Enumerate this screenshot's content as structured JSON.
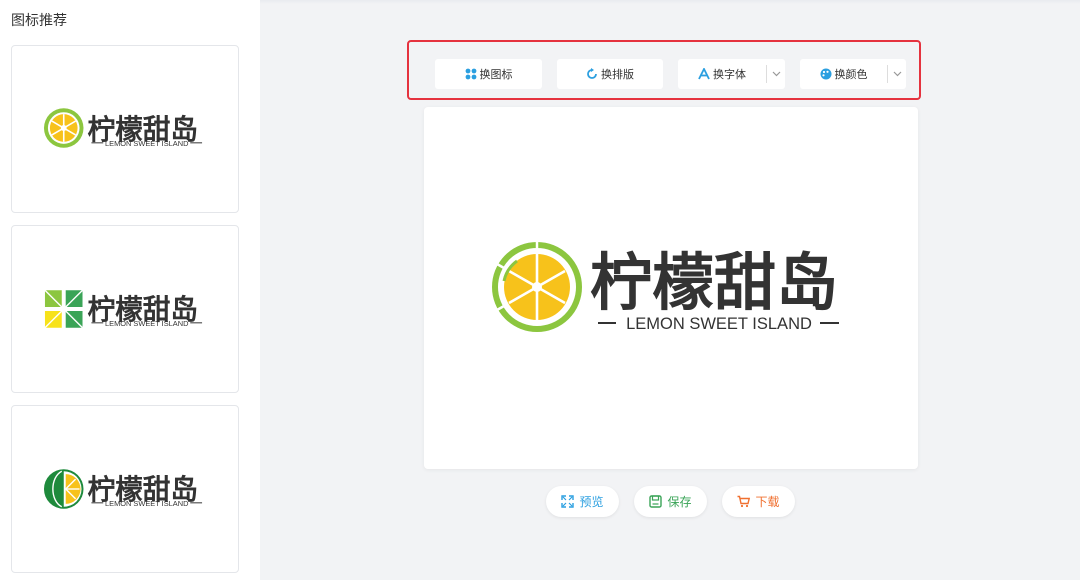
{
  "sidebar": {
    "title": "图标推荐",
    "cards": [
      {
        "name_cn": "柠檬甜岛",
        "name_en": "LEMON SWEET ISLAND",
        "icon": "lemon-slice-icon"
      },
      {
        "name_cn": "柠檬甜岛",
        "name_en": "LEMON SWEET ISLAND",
        "icon": "four-leaf-icon"
      },
      {
        "name_cn": "柠檬甜岛",
        "name_en": "LEMON SWEET ISLAND",
        "icon": "half-lemon-leaf-icon"
      }
    ]
  },
  "toolbar": {
    "change_icon": "换图标",
    "change_layout": "换排版",
    "change_font": "换字体",
    "change_color": "换颜色"
  },
  "canvas": {
    "name_cn": "柠檬甜岛",
    "name_en": "LEMON SWEET ISLAND",
    "icon": "lemon-slice-icon"
  },
  "actions": {
    "preview": "预览",
    "save": "保存",
    "download": "下载"
  },
  "colors": {
    "lemon_green": "#8cc63f",
    "lemon_yellow": "#f7c21b",
    "text_dark": "#333333",
    "highlight_red": "#e5323e",
    "preview_blue": "#2b9fe0",
    "save_green": "#3aa457",
    "download_orange": "#f07030"
  }
}
